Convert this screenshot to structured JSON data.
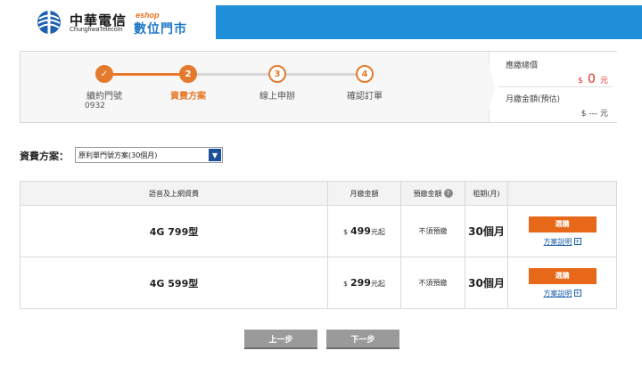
{
  "header": {
    "brand_cn": "中華電信",
    "brand_en": "ChunghwaTelecom",
    "eshop_label": "eshop",
    "eshop_title": "數位門市",
    "bar_color": "#1e8fd8"
  },
  "progress": {
    "steps": [
      {
        "number": "✓",
        "label": "續約門號",
        "state": "done"
      },
      {
        "number": "2",
        "label": "資費方案",
        "state": "active"
      },
      {
        "number": "3",
        "label": "線上申辦",
        "state": "pending"
      },
      {
        "number": "4",
        "label": "確認訂單",
        "state": "pending"
      }
    ],
    "phone_number": "0932"
  },
  "summary": {
    "total_label": "應繳總價",
    "total_currency": "$",
    "total_value": "0",
    "total_unit": "元",
    "monthly_label": "月繳金額(預估)",
    "monthly_value": "$ --- 元"
  },
  "plan_selector": {
    "label": "資費方案：",
    "selected": "原利單門號方案(30個月)"
  },
  "table": {
    "headers": [
      "語音及上網資費",
      "月繳金額",
      "預繳金額",
      "租期(月)",
      ""
    ],
    "rows": [
      {
        "name": "4G 799型",
        "price_currency": "$",
        "price": "499",
        "price_unit": "元起",
        "deposit": "不須預繳",
        "term": "30個月",
        "select_label": "選購",
        "detail_label": "方案說明"
      },
      {
        "name": "4G 599型",
        "price_currency": "$",
        "price": "299",
        "price_unit": "元起",
        "deposit": "不須預繳",
        "term": "30個月",
        "select_label": "選購",
        "detail_label": "方案說明"
      }
    ]
  },
  "nav": {
    "prev_label": "上一步",
    "next_label": "下一步"
  },
  "colors": {
    "accent": "#e57a2c",
    "brand_blue": "#1e8fd8",
    "price_red": "#e0302a"
  }
}
